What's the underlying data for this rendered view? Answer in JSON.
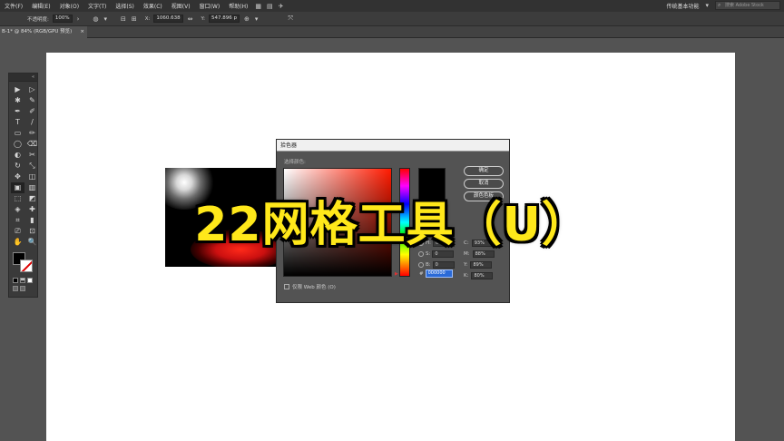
{
  "menubar": {
    "items": [
      "文件(F)",
      "编辑(E)",
      "对象(O)",
      "文字(T)",
      "选择(S)",
      "效果(C)",
      "视图(V)",
      "窗口(W)",
      "帮助(H)"
    ],
    "workspace": "传统基本功能",
    "search_placeholder": "搜索 Adobe Stock"
  },
  "controlbar": {
    "opacity_label": "不透明度:",
    "opacity_value": "100%",
    "x_value": "1060.638",
    "y_value": "547.896 p"
  },
  "tab": {
    "title": "B-1* @ 84% (RGB/GPU 预览)",
    "close": "×"
  },
  "toolbar": {
    "grip": "«",
    "tools": [
      "▶",
      "▷",
      "✱",
      "✎",
      "✒",
      "✐",
      "T",
      "/",
      "▭",
      "✏",
      "◯",
      "⌫",
      "◐",
      "✂",
      "↻",
      "⤡",
      "✥",
      "◫",
      "▣",
      "▥",
      "⬚",
      "◩",
      "◈",
      "✚",
      "⌗",
      "▮",
      "⎚",
      "⊡",
      "✋",
      "🔍"
    ]
  },
  "dialog": {
    "title": "拾色器",
    "subtitle": "选择颜色:",
    "ok": "确定",
    "cancel": "取消",
    "swatches": "颜色色板",
    "h_label": "H:",
    "h_value": "0°",
    "s_label": "S:",
    "s_value": "0",
    "b_label": "B:",
    "b_value": "0",
    "hex_label": "#",
    "hex_value": "000000",
    "c_label": "C:",
    "c_value": "93%",
    "m_label": "M:",
    "m_value": "88%",
    "y_label": "Y:",
    "y_value": "89%",
    "k_label": "K:",
    "k_value": "80%",
    "web_only": "仅限 Web 颜色 (O)"
  },
  "caption": "22网格工具（U）"
}
